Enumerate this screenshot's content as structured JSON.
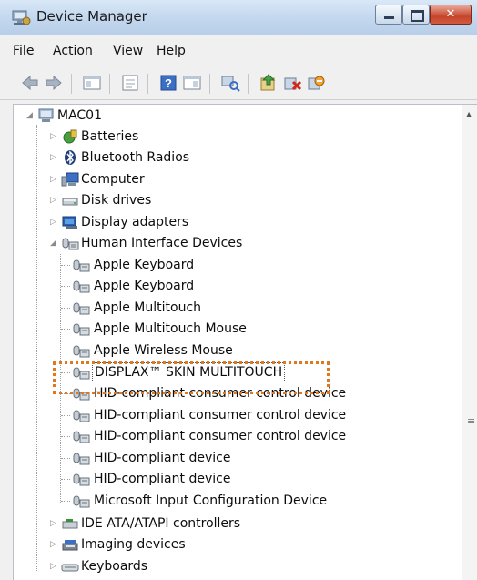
{
  "window": {
    "title": "Device Manager",
    "icon": "device-manager-icon",
    "controls": {
      "minimize": "minimize",
      "maximize": "maximize",
      "close": "✕"
    }
  },
  "menu": [
    "File",
    "Action",
    "View",
    "Help"
  ],
  "toolbar": [
    "back-arrow-icon",
    "forward-arrow-icon",
    "show-hide-console-tree-icon",
    "properties-icon",
    "help-icon",
    "show-action-pane-icon",
    "scan-hardware-changes-icon",
    "update-driver-icon",
    "uninstall-icon",
    "disable-device-icon"
  ],
  "tree": {
    "root": "MAC01",
    "categories": [
      {
        "label": "Batteries",
        "icon": "battery-icon"
      },
      {
        "label": "Bluetooth Radios",
        "icon": "bluetooth-icon"
      },
      {
        "label": "Computer",
        "icon": "computer-icon"
      },
      {
        "label": "Disk drives",
        "icon": "disk-drive-icon"
      },
      {
        "label": "Display adapters",
        "icon": "display-adapter-icon"
      },
      {
        "label": "Human Interface Devices",
        "icon": "hid-icon",
        "expanded": true,
        "children": [
          "Apple Keyboard",
          "Apple Keyboard",
          "Apple Multitouch",
          "Apple Multitouch Mouse",
          "Apple Wireless Mouse",
          "DISPLAX™ SKIN MULTITOUCH",
          "HID-compliant consumer control device",
          "HID-compliant consumer control device",
          "HID-compliant consumer control device",
          "HID-compliant device",
          "HID-compliant device",
          "Microsoft Input Configuration Device"
        ]
      },
      {
        "label": "IDE ATA/ATAPI controllers",
        "icon": "ide-controller-icon"
      },
      {
        "label": "Imaging devices",
        "icon": "imaging-device-icon"
      },
      {
        "label": "Keyboards",
        "icon": "keyboard-icon"
      }
    ],
    "highlighted_device": "DISPLAX™ SKIN MULTITOUCH"
  },
  "colors": {
    "highlight_outline": "#e2781d",
    "titlebar": "#c5d9ef",
    "close_button": "#c5452c"
  }
}
